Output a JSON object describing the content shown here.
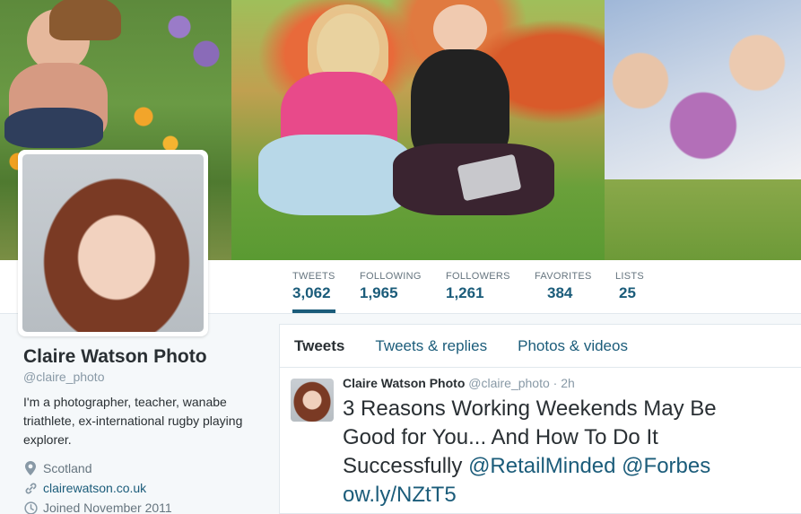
{
  "banner": {
    "left_photo": "woman-sitting-in-garden-photo",
    "center_photo": "two-women-with-laptop-photo",
    "right_photo": "group-of-women-looking-down-photo"
  },
  "stats": [
    {
      "label": "TWEETS",
      "value": "3,062"
    },
    {
      "label": "FOLLOWING",
      "value": "1,965"
    },
    {
      "label": "FOLLOWERS",
      "value": "1,261"
    },
    {
      "label": "FAVORITES",
      "value": "384"
    },
    {
      "label": "LISTS",
      "value": "25"
    }
  ],
  "profile": {
    "name": "Claire Watson Photo",
    "handle": "@claire_photo",
    "bio": "I'm a photographer, teacher, wanabe triathlete, ex-international rugby playing explorer.",
    "location": "Scotland",
    "website": "clairewatson.co.uk",
    "joined": "Joined November 2011"
  },
  "tabs": [
    {
      "label": "Tweets"
    },
    {
      "label": "Tweets & replies"
    },
    {
      "label": "Photos & videos"
    }
  ],
  "tweet": {
    "name": "Claire Watson Photo",
    "handle": "@claire_photo",
    "time": "· 2h",
    "text": "3 Reasons Working Weekends May Be Good for You... And How To Do It Successfully",
    "mention1": "@RetailMinded",
    "mention2": "@Forbes",
    "link": "ow.ly/NZtT5"
  },
  "colors": {
    "accent": "#1b5c7a",
    "muted": "#8899a6"
  }
}
